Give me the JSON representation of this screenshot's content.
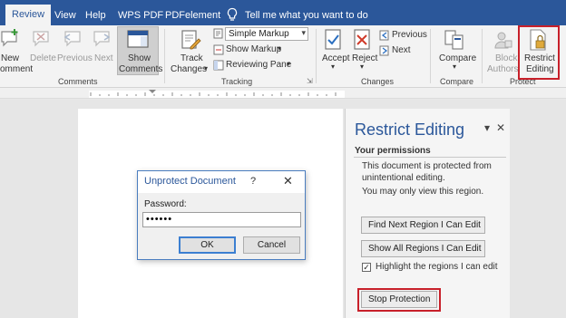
{
  "tabs": [
    {
      "label": "Review",
      "active": true
    },
    {
      "label": "View"
    },
    {
      "label": "Help"
    },
    {
      "label": "WPS PDF"
    },
    {
      "label": "PDFelement"
    }
  ],
  "tell_me": "Tell me what you want to do",
  "ribbon": {
    "comments": {
      "new_line1": "New",
      "new_line2": "omment",
      "delete": "Delete",
      "previous": "Previous",
      "next": "Next",
      "show_line1": "Show",
      "show_line2": "Comments",
      "group": "Comments"
    },
    "tracking": {
      "track_line1": "Track",
      "track_line2": "Changes",
      "markup_select": "Simple Markup",
      "show_markup": "Show Markup",
      "reviewing_pane": "Reviewing Pane",
      "group": "Tracking"
    },
    "changes": {
      "accept": "Accept",
      "reject": "Reject",
      "previous": "Previous",
      "next": "Next",
      "group": "Changes"
    },
    "compare": {
      "compare": "Compare",
      "group": "Compare"
    },
    "protect": {
      "block_line1": "Block",
      "block_line2": "Authors",
      "restrict_line1": "Restrict",
      "restrict_line2": "Editing",
      "group": "Protect"
    }
  },
  "dialog": {
    "title": "Unprotect Document",
    "help": "?",
    "close": "✕",
    "password_label": "Password:",
    "password_value": "••••••",
    "ok": "OK",
    "cancel": "Cancel"
  },
  "pane": {
    "title": "Restrict Editing",
    "dropdown": "▾",
    "close": "✕",
    "permissions_heading": "Your permissions",
    "desc_line1": "This document is protected from",
    "desc_line2": "unintentional editing.",
    "desc_line3": "You may only view this region.",
    "find_next": "Find Next Region I Can Edit",
    "show_all": "Show All Regions I Can Edit",
    "highlight_label": "Highlight the regions I can edit",
    "highlight_checked": "✓",
    "stop_protection": "Stop Protection"
  },
  "colors": {
    "accent": "#2b579a",
    "highlight": "#c8202a"
  }
}
